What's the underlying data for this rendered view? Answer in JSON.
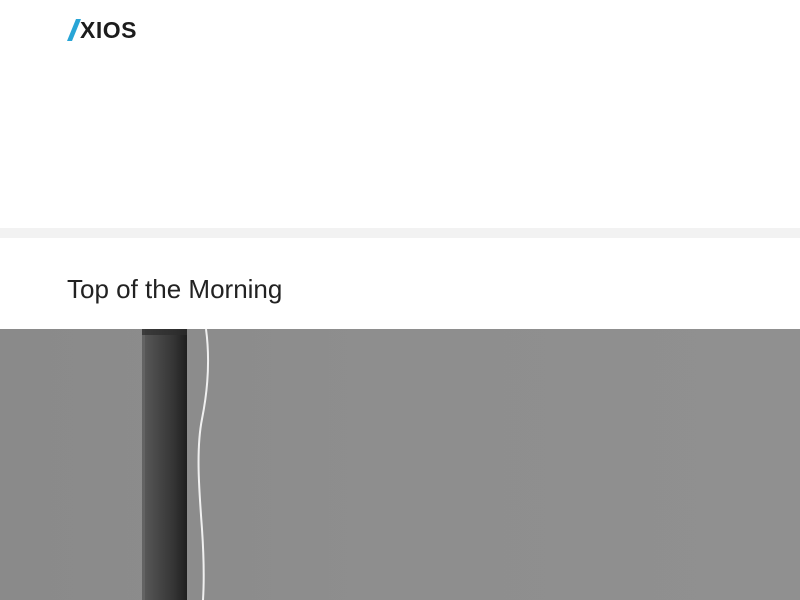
{
  "brand": {
    "name": "XIOS",
    "accent_color": "#28a5d6",
    "text_color": "#1c1c1c"
  },
  "section": {
    "title": "Top of the Morning"
  },
  "hero": {
    "icon": "pole-with-cable-image",
    "background_color": "#8a8a8a"
  },
  "colors": {
    "divider": "#f2f2f2",
    "title": "#222222"
  }
}
